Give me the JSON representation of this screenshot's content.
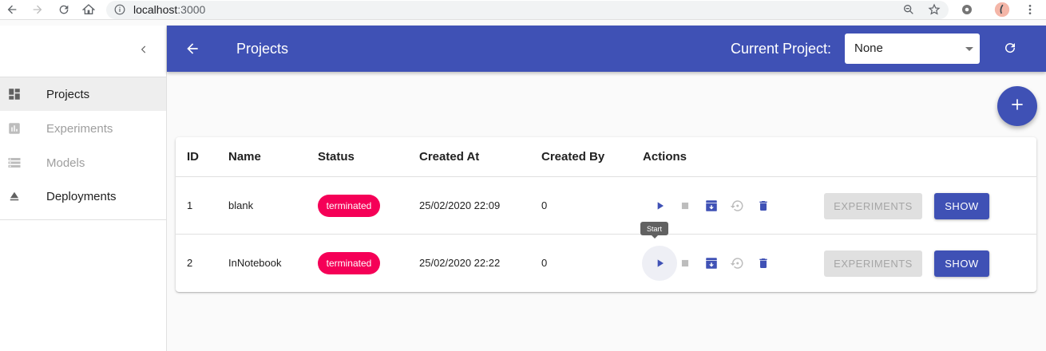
{
  "browser": {
    "url_host": "localhost",
    "url_port": ":3000"
  },
  "sidebar": {
    "items": [
      {
        "label": "Projects",
        "icon": "dashboard-icon",
        "active": true
      },
      {
        "label": "Experiments",
        "icon": "bar-chart-icon",
        "disabled": true
      },
      {
        "label": "Models",
        "icon": "storage-icon",
        "disabled": true
      },
      {
        "label": "Deployments",
        "icon": "eject-icon"
      }
    ]
  },
  "appbar": {
    "title": "Projects",
    "current_project_label": "Current Project:",
    "current_project_value": "None"
  },
  "table": {
    "headers": [
      "ID",
      "Name",
      "Status",
      "Created At",
      "Created By",
      "Actions"
    ],
    "rows": [
      {
        "id": "1",
        "name": "blank",
        "status": "terminated",
        "created_at": "25/02/2020 22:09",
        "created_by": "0"
      },
      {
        "id": "2",
        "name": "InNotebook",
        "status": "terminated",
        "created_at": "25/02/2020 22:22",
        "created_by": "0"
      }
    ],
    "experiments_label": "EXPERIMENTS",
    "show_label": "SHOW"
  },
  "tooltip": {
    "text": "Start"
  },
  "colors": {
    "primary": "#3f51b5",
    "accent": "#f50057"
  }
}
